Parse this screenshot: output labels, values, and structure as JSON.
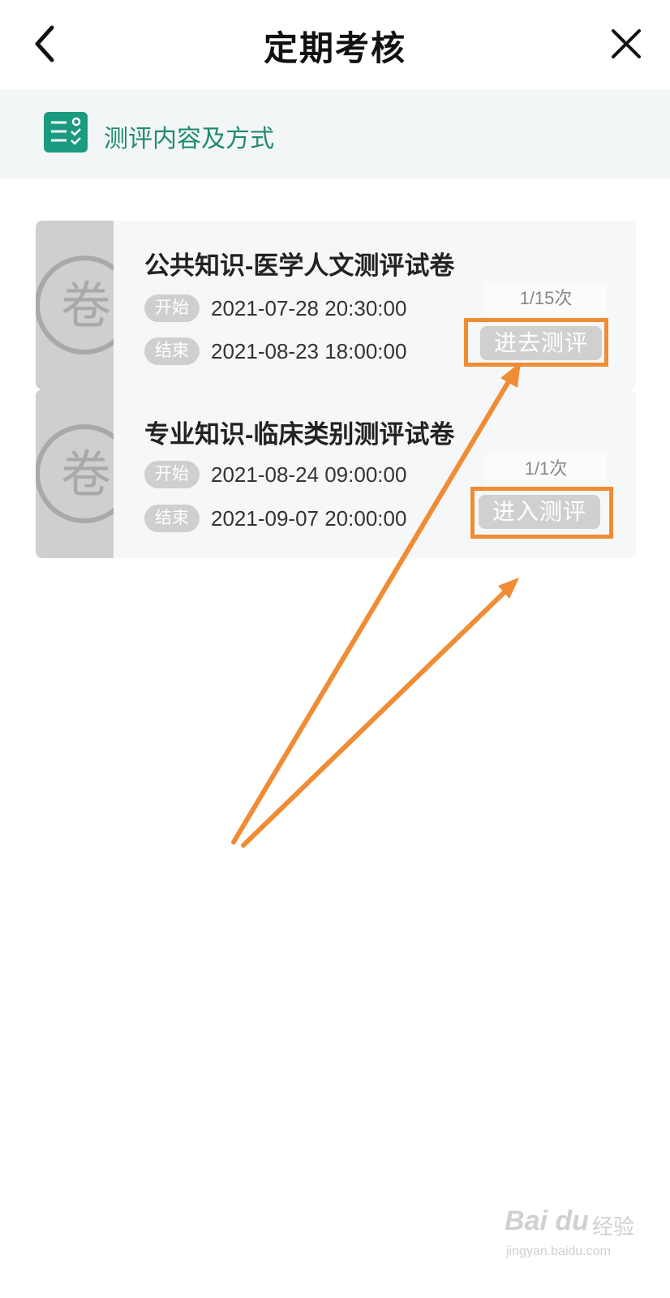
{
  "header": {
    "title": "定期考核",
    "back_icon": "chevron-left-icon",
    "close_icon": "close-icon"
  },
  "section": {
    "label": "测评内容及方式",
    "icon": "checklist-icon",
    "accent_color": "#1a9a7f"
  },
  "exams": [
    {
      "badge": "卷",
      "title": "公共知识-医学人文测评试卷",
      "start_label": "开始",
      "start_time": "2021-07-28 20:30:00",
      "end_label": "结束",
      "end_time": "2021-08-23 18:00:00",
      "count": "1/15次",
      "action_label": "进去测评"
    },
    {
      "badge": "卷",
      "title": "专业知识-临床类别测评试卷",
      "start_label": "开始",
      "start_time": "2021-08-24 09:00:00",
      "end_label": "结束",
      "end_time": "2021-09-07 20:00:00",
      "count": "1/1次",
      "action_label": "进入测评"
    }
  ],
  "annotation": {
    "highlight_color": "#f08c34"
  },
  "watermark": {
    "brand": "Bai du",
    "brand_cn": "经验",
    "url": "jingyan.baidu.com"
  }
}
